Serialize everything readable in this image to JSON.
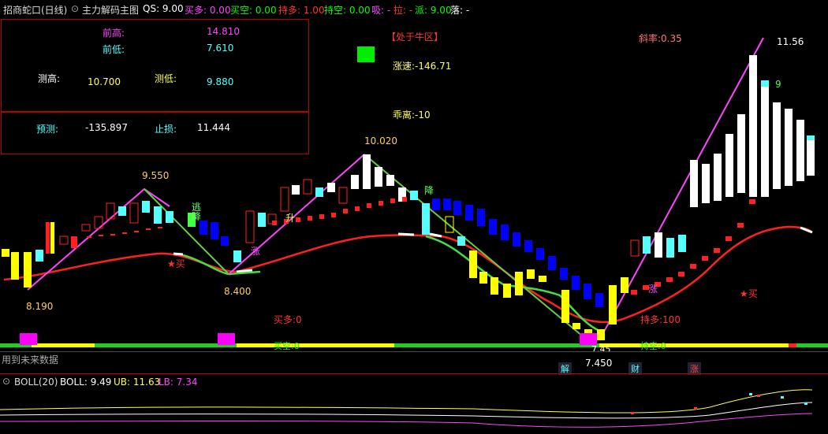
{
  "header": {
    "title": "招商蛇口(日线)",
    "indicator_menu": "主力解码主图",
    "qs": "QS: 9.00",
    "buy_long": "买多: 0.00",
    "buy_short": "买空: 0.00",
    "hold_long": "持多: 1.00",
    "hold_short": "持空: 0.00",
    "absorb": "吸: -",
    "pull": "拉: -",
    "dispatch": "派: 9.00",
    "fall": "落: -"
  },
  "panel": {
    "prev_high_label": "前高:",
    "prev_high_value": "14.810",
    "prev_low_label": "前低:",
    "prev_low_value": "7.610",
    "measured_high_label": "测高:",
    "measured_high_value": "10.700",
    "measured_low_label": "测低:",
    "measured_low_value": "9.880",
    "forecast_label": "预测:",
    "forecast_value": "-135.897",
    "stop_loss_label": "止损:",
    "stop_loss_value": "11.444"
  },
  "annotations": {
    "zone": "【处于牛区】",
    "rise_speed": "涨速:-146.71",
    "deviation": "乖离:-10",
    "slope": "斜率:0.35",
    "buy_long_mid": "买多:0",
    "buy_short_mid": "买空:0",
    "hold_long_mid": "持多:100",
    "hold_short_mid": "持空:0",
    "escape": "逃",
    "drop1": "降",
    "drop2": "降",
    "rise_char": "升",
    "rise_char2": "涨",
    "rise_char3": "涨",
    "buy_star1": "★买",
    "buy_star2": "★买",
    "nine": "9"
  },
  "price_labels": {
    "p1": "9.550",
    "p2": "8.190",
    "p3": "8.400",
    "p4": "10.020",
    "p5": "7.45",
    "p6": "11.56"
  },
  "footer": {
    "notice": "用到未来数据",
    "low_value": "7.450",
    "badge1": "解",
    "badge2": "财",
    "badge3": "涨"
  },
  "boll": {
    "name": "BOLL(20)",
    "boll": "BOLL: 9.49",
    "ub": "UB: 11.63",
    "lb": "LB: 7.34"
  },
  "colors": {
    "red": "#ff3333",
    "green": "#00ff00",
    "yellow": "#ffff00",
    "cyan": "#55ffff",
    "magenta": "#ff00ff",
    "blue": "#0000ff",
    "white": "#ffffff"
  }
}
